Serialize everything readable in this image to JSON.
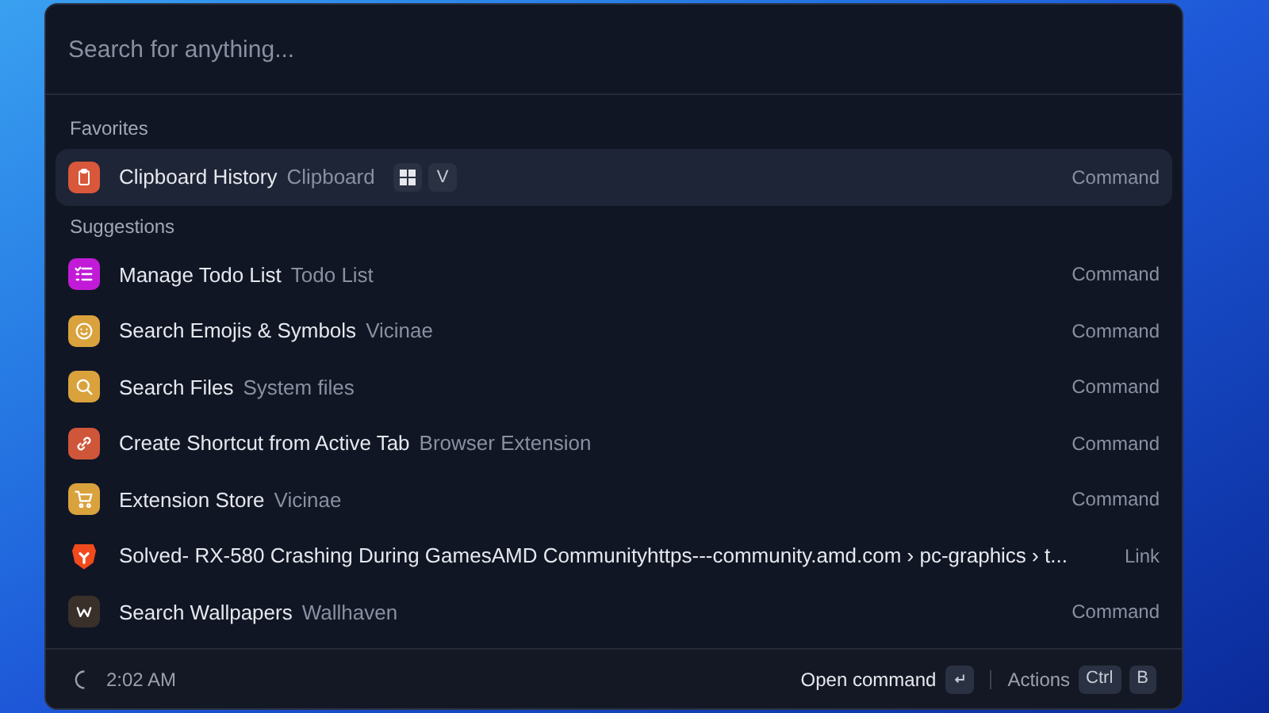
{
  "search": {
    "placeholder": "Search for anything..."
  },
  "sections": [
    {
      "title": "Favorites",
      "items": [
        {
          "title": "Clipboard History",
          "subtitle": "Clipboard",
          "shortcut": [
            {
              "kind": "windows"
            },
            {
              "kind": "key",
              "label": "V"
            }
          ],
          "type": "Command",
          "selected": true
        }
      ]
    },
    {
      "title": "Suggestions",
      "items": [
        {
          "title": "Manage Todo List",
          "subtitle": "Todo List",
          "type": "Command",
          "selected": false
        },
        {
          "title": "Search Emojis & Symbols",
          "subtitle": "Vicinae",
          "type": "Command",
          "selected": false
        },
        {
          "title": "Search Files",
          "subtitle": "System files",
          "type": "Command",
          "selected": false
        },
        {
          "title": "Create Shortcut from Active Tab",
          "subtitle": "Browser Extension",
          "type": "Command",
          "selected": false
        },
        {
          "title": "Extension Store",
          "subtitle": "Vicinae",
          "type": "Command",
          "selected": false
        },
        {
          "title": "Solved- RX-580 Crashing During GamesAMD Communityhttps---community.amd.com › pc-graphics › t...",
          "type": "Link",
          "selected": false
        },
        {
          "title": "Search Wallpapers",
          "subtitle": "Wallhaven",
          "type": "Command",
          "selected": false
        }
      ]
    }
  ],
  "footer": {
    "time": "2:02 AM",
    "primary_action": "Open command",
    "actions_label": "Actions",
    "actions_keys": [
      "Ctrl",
      "B"
    ]
  }
}
